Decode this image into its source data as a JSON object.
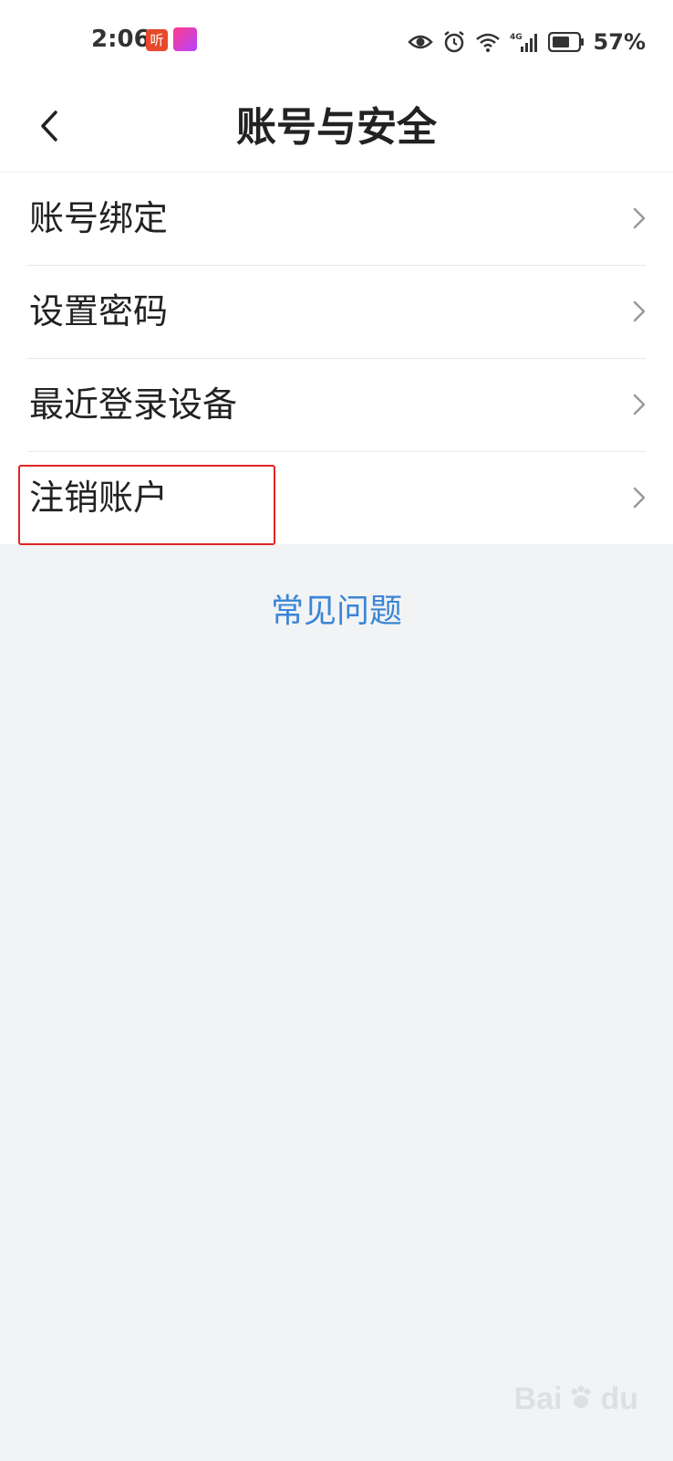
{
  "status_bar": {
    "time": "2:06",
    "app_icon_1_text": "听",
    "battery_percent": "57%",
    "network": "4G"
  },
  "header": {
    "title": "账号与安全"
  },
  "menu": {
    "items": [
      {
        "label": "账号绑定"
      },
      {
        "label": "设置密码"
      },
      {
        "label": "最近登录设备"
      },
      {
        "label": "注销账户"
      }
    ]
  },
  "faq": {
    "label": "常见问题"
  },
  "colors": {
    "background": "#f2f3f5",
    "link": "#3a86d6",
    "highlight": "#e02424"
  }
}
